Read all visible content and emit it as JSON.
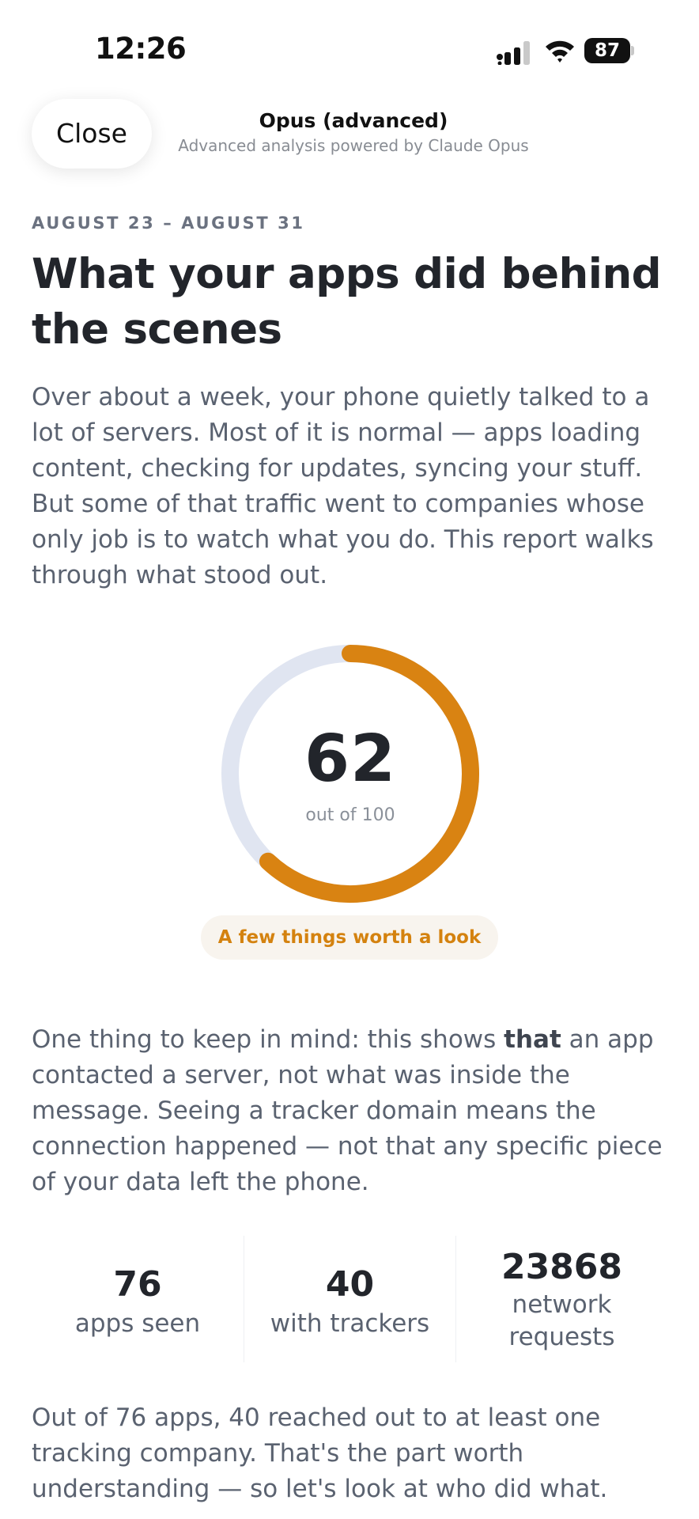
{
  "status_bar": {
    "time": "12:26",
    "battery_level": "87",
    "icons": [
      "cellular-signal-icon",
      "wifi-icon",
      "battery-icon"
    ]
  },
  "header": {
    "close_label": "Close",
    "title": "Opus (advanced)",
    "subtitle": "Advanced analysis powered by Claude Opus"
  },
  "report": {
    "date_range": "AUGUST 23 – AUGUST 31",
    "headline": "What your apps did behind the scenes",
    "intro": "Over about a week, your phone quietly talked to a lot of servers. Most of it is normal — apps loading content, checking for updates, syncing your stuff. But some of that traffic went to companies whose only job is to watch what you do. This report walks through what stood out.",
    "score": {
      "value": 62,
      "max": 100,
      "caption": "out of 100",
      "verdict": "A few things worth a look",
      "track_color": "#e0e5f1",
      "fill_color": "#d98312"
    },
    "note": {
      "before": "One thing to keep in mind: this shows ",
      "emphasis": "that",
      "after": " an app contacted a server, not what was inside the message. Seeing a tracker domain means the connection happened — not that any specific piece of your data left the phone."
    },
    "stats": [
      {
        "value": "76",
        "label": "apps seen"
      },
      {
        "value": "40",
        "label": "with trackers"
      },
      {
        "value": "23868",
        "label": "network requests"
      }
    ],
    "summary": "Out of 76 apps, 40 reached out to at least one tracking company. That's the part worth understanding — so let's look at who did what."
  }
}
